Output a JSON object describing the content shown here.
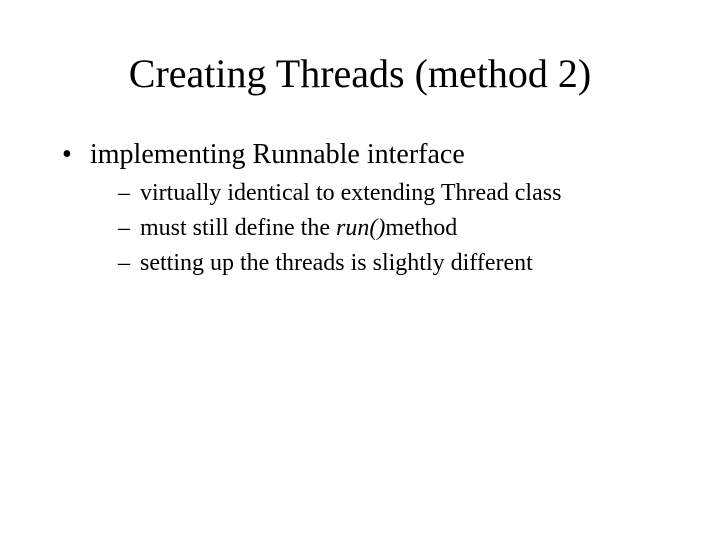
{
  "title": "Creating Threads (method 2)",
  "bullet1": "implementing Runnable interface",
  "sub1": "virtually identical to extending Thread class",
  "sub2_pre": "must still define the ",
  "sub2_run": "run()",
  "sub2_post": "method",
  "sub3": "setting up the threads is slightly different"
}
